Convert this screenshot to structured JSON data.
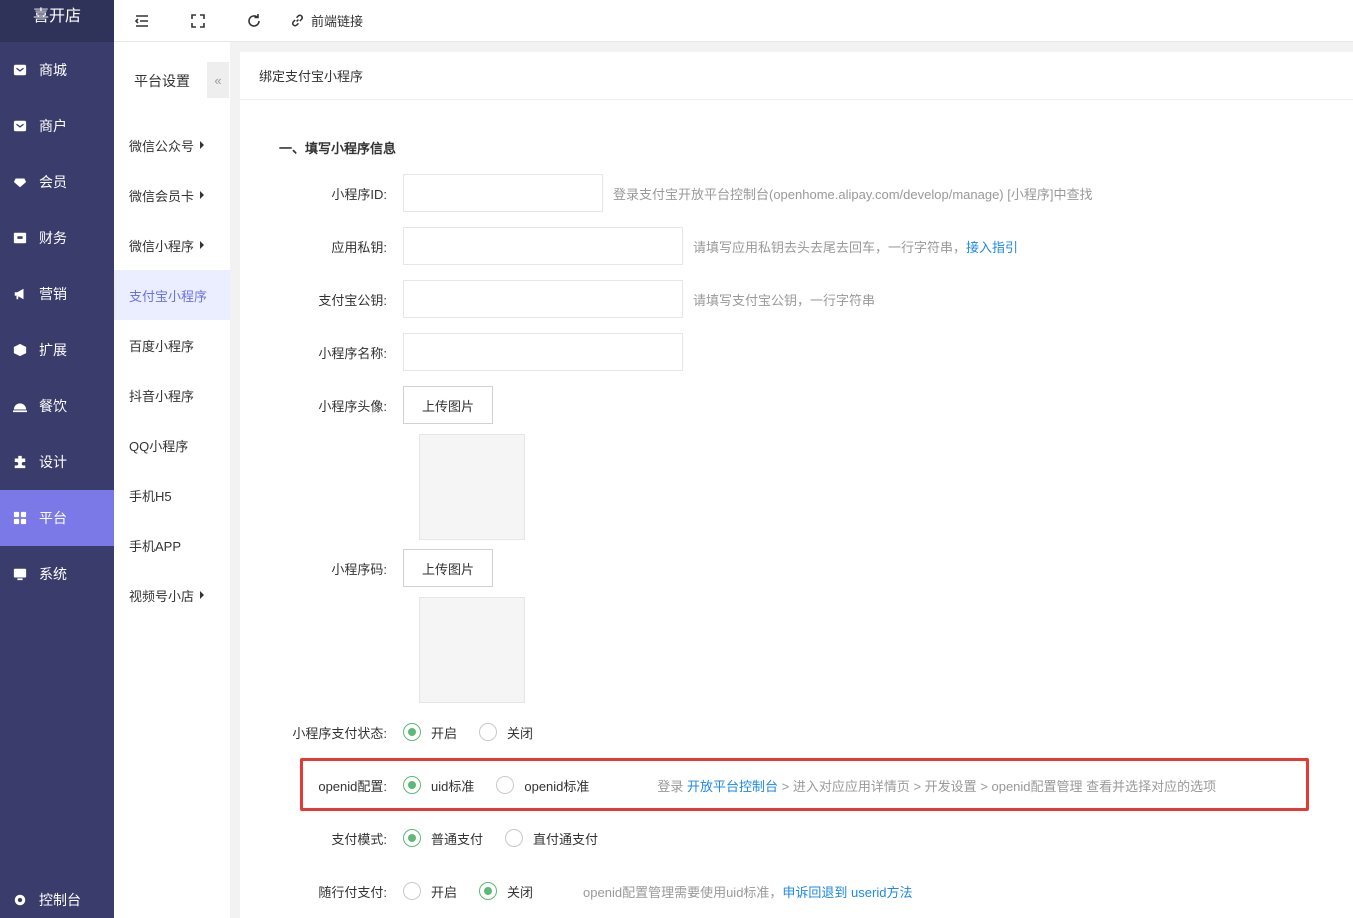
{
  "brand": "喜开店",
  "sidebar": {
    "items": [
      {
        "label": "商城",
        "icon": "shop-icon"
      },
      {
        "label": "商户",
        "icon": "merchant-icon"
      },
      {
        "label": "会员",
        "icon": "member-icon"
      },
      {
        "label": "财务",
        "icon": "finance-icon"
      },
      {
        "label": "营销",
        "icon": "megaphone-icon"
      },
      {
        "label": "扩展",
        "icon": "cube-icon"
      },
      {
        "label": "餐饮",
        "icon": "dish-icon"
      },
      {
        "label": "设计",
        "icon": "puzzle-icon"
      },
      {
        "label": "平台",
        "icon": "grid-icon"
      },
      {
        "label": "系统",
        "icon": "system-icon"
      }
    ],
    "bottom_label": "控制台"
  },
  "topbar": {
    "link_label": "前端链接"
  },
  "subnav": {
    "title": "平台设置",
    "collapse": "«",
    "items": [
      {
        "label": "微信公众号"
      },
      {
        "label": "微信会员卡"
      },
      {
        "label": "微信小程序"
      },
      {
        "label": "支付宝小程序"
      },
      {
        "label": "百度小程序"
      },
      {
        "label": "抖音小程序"
      },
      {
        "label": "QQ小程序"
      },
      {
        "label": "手机H5"
      },
      {
        "label": "手机APP"
      },
      {
        "label": "视频号小店"
      }
    ]
  },
  "page": {
    "header": "绑定支付宝小程序",
    "section_title": "一、填写小程序信息"
  },
  "form": {
    "appid": {
      "label": "小程序ID:",
      "value": "",
      "hint": "登录支付宝开放平台控制台(openhome.alipay.com/develop/manage) [小程序]中查找"
    },
    "private_key": {
      "label": "应用私钥:",
      "value": "",
      "hint": "请填写应用私钥去头去尾去回车，一行字符串，",
      "link": "接入指引"
    },
    "public_key": {
      "label": "支付宝公钥:",
      "value": "",
      "hint": "请填写支付宝公钥，一行字符串"
    },
    "name": {
      "label": "小程序名称:",
      "value": ""
    },
    "avatar": {
      "label": "小程序头像:",
      "button": "上传图片"
    },
    "qrcode": {
      "label": "小程序码:",
      "button": "上传图片"
    },
    "pay_status": {
      "label": "小程序支付状态:",
      "options": [
        "开启",
        "关闭"
      ]
    },
    "openid": {
      "label": "openid配置:",
      "options": [
        "uid标准",
        "openid标准"
      ],
      "hint_pre": "登录 ",
      "hint_link": "开放平台控制台",
      "hint_post": " > 进入对应应用详情页 > 开发设置 > openid配置管理 查看并选择对应的选项"
    },
    "pay_mode": {
      "label": "支付模式:",
      "options": [
        "普通支付",
        "直付通支付"
      ]
    },
    "follow_pay": {
      "label": "随行付支付:",
      "options": [
        "开启",
        "关闭"
      ],
      "hint": "openid配置管理需要使用uid标准，",
      "hint_link": "申诉回退到 userid方法"
    }
  }
}
